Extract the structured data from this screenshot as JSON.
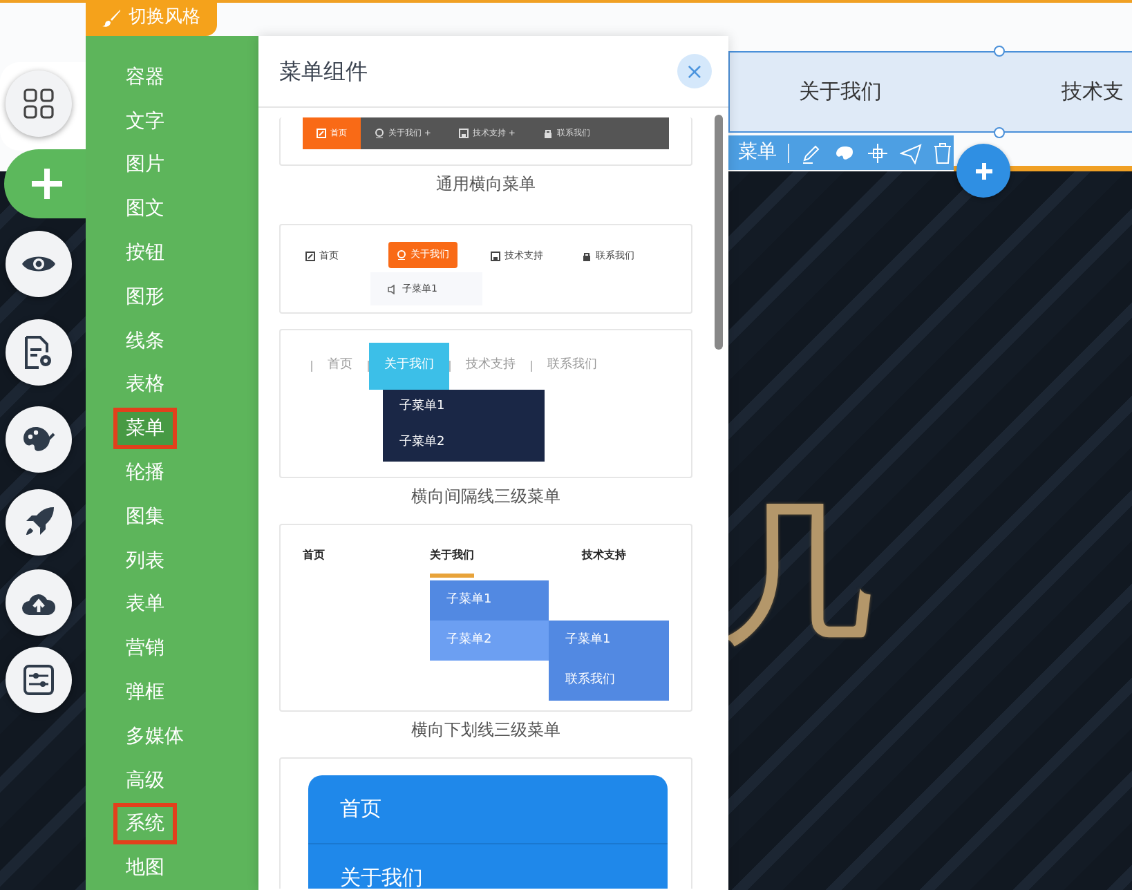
{
  "style_button": {
    "label": "切换风格"
  },
  "rail": [
    {
      "kind": "grid",
      "selected": false
    },
    {
      "kind": "add",
      "selected": true
    },
    {
      "kind": "preview",
      "selected": false
    },
    {
      "kind": "page",
      "selected": false
    },
    {
      "kind": "theme",
      "selected": false
    },
    {
      "kind": "publish",
      "selected": false
    },
    {
      "kind": "upload",
      "selected": false
    },
    {
      "kind": "settings",
      "selected": false
    }
  ],
  "categories": [
    {
      "label": "容器",
      "selected": false,
      "outlined": false
    },
    {
      "label": "文字",
      "selected": false,
      "outlined": false
    },
    {
      "label": "图片",
      "selected": false,
      "outlined": false
    },
    {
      "label": "图文",
      "selected": false,
      "outlined": false
    },
    {
      "label": "按钮",
      "selected": false,
      "outlined": false
    },
    {
      "label": "图形",
      "selected": false,
      "outlined": false
    },
    {
      "label": "线条",
      "selected": false,
      "outlined": false
    },
    {
      "label": "表格",
      "selected": false,
      "outlined": false
    },
    {
      "label": "菜单",
      "selected": true,
      "outlined": true
    },
    {
      "label": "轮播",
      "selected": false,
      "outlined": false
    },
    {
      "label": "图集",
      "selected": false,
      "outlined": false
    },
    {
      "label": "列表",
      "selected": false,
      "outlined": false
    },
    {
      "label": "表单",
      "selected": false,
      "outlined": false
    },
    {
      "label": "营销",
      "selected": false,
      "outlined": false
    },
    {
      "label": "弹框",
      "selected": false,
      "outlined": false
    },
    {
      "label": "多媒体",
      "selected": false,
      "outlined": false
    },
    {
      "label": "高级",
      "selected": false,
      "outlined": false
    },
    {
      "label": "系统",
      "selected": false,
      "outlined": true
    },
    {
      "label": "地图",
      "selected": false,
      "outlined": false
    }
  ],
  "panel": {
    "title": "菜单组件",
    "close": "×",
    "templates": [
      {
        "kind": "bar",
        "caption": "通用横向菜单",
        "items": [
          {
            "label": "首页",
            "selected": true
          },
          {
            "label": "关于我们 +",
            "selected": false
          },
          {
            "label": "技术支持 +",
            "selected": false
          },
          {
            "label": "联系我们",
            "selected": false
          }
        ]
      },
      {
        "kind": "pill",
        "items": [
          {
            "label": "首页",
            "selected": false
          },
          {
            "label": "关于我们",
            "selected": true
          },
          {
            "label": "技术支持",
            "selected": false
          },
          {
            "label": "联系我们",
            "selected": false
          }
        ],
        "submenu": [
          {
            "label": "子菜单1",
            "selected": false
          }
        ]
      },
      {
        "kind": "divider",
        "caption": "横向间隔线三级菜单",
        "items": [
          {
            "label": "首页",
            "selected": false
          },
          {
            "label": "关于我们",
            "selected": true
          },
          {
            "label": "技术支持",
            "selected": false
          },
          {
            "label": "联系我们",
            "selected": false
          }
        ],
        "submenu": [
          {
            "label": "子菜单1",
            "selected": false
          },
          {
            "label": "子菜单2",
            "selected": false
          }
        ]
      },
      {
        "kind": "underline",
        "caption": "横向下划线三级菜单",
        "items": [
          {
            "label": "首页",
            "selected": false
          },
          {
            "label": "关于我们",
            "selected": true
          },
          {
            "label": "技术支持",
            "selected": false
          }
        ],
        "submenu": [
          {
            "label": "子菜单1",
            "selected": false
          },
          {
            "label": "子菜单2",
            "selected": true
          }
        ],
        "subsubmenu": [
          {
            "label": "子菜单1",
            "selected": false
          },
          {
            "label": "联系我们",
            "selected": false
          }
        ]
      },
      {
        "kind": "vertical",
        "items": [
          {
            "label": "首页",
            "selected": false
          },
          {
            "label": "关于我们",
            "selected": false
          }
        ]
      }
    ]
  },
  "canvas": {
    "menu_items": [
      "关于我们",
      "技术支"
    ],
    "toolbar_label": "菜单",
    "hero_text": "几"
  }
}
